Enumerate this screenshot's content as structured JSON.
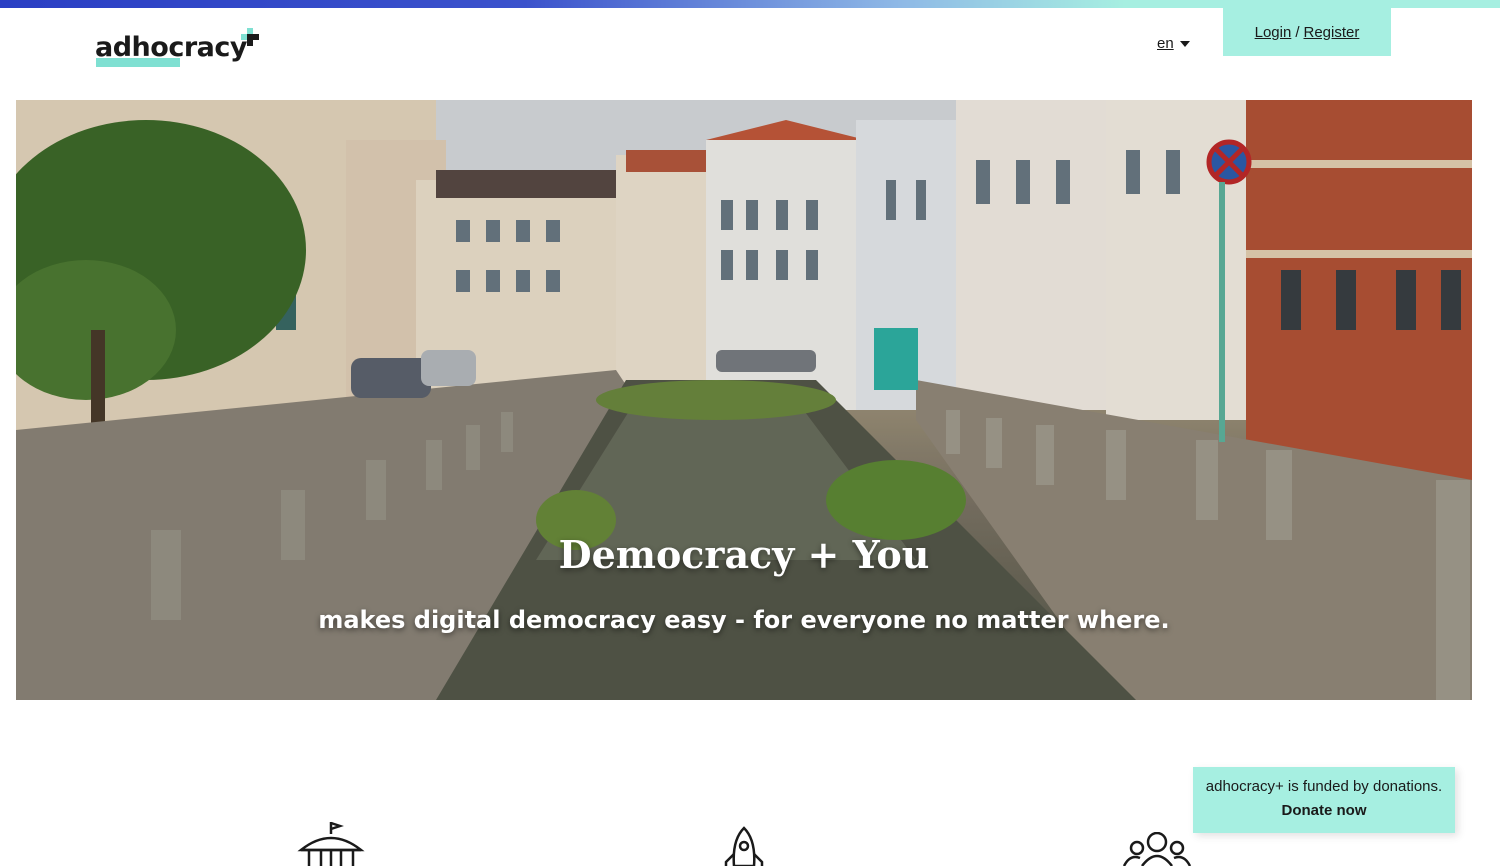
{
  "header": {
    "logo_text": "adhocracy",
    "language": "en",
    "login_label": "Login",
    "separator": "/",
    "register_label": "Register"
  },
  "hero": {
    "title": "Democracy + You",
    "subtitle": "makes digital democracy easy - for everyone no matter where."
  },
  "donation": {
    "message": "adhocracy+ is funded by donations.",
    "button_label": "Donate now"
  },
  "features": {
    "icons": [
      "townhall-icon",
      "rocket-icon",
      "people-group-icon"
    ]
  },
  "colors": {
    "accent": "#a6efe1",
    "logo_accent": "#7fe0d2",
    "topbar_start": "#2a3fc4",
    "text": "#1a1a1a"
  }
}
